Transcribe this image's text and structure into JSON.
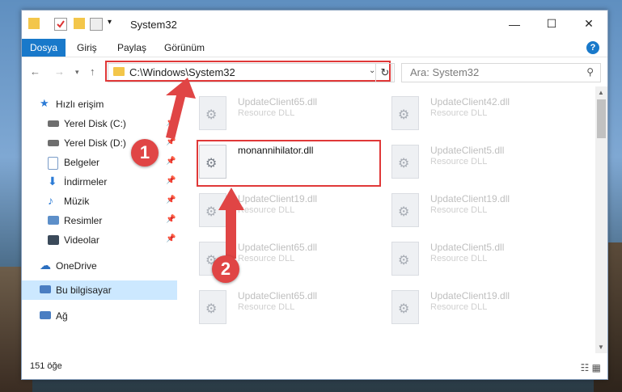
{
  "window": {
    "title": "System32"
  },
  "ribbon": {
    "tabs": [
      {
        "label": "Dosya",
        "active": true
      },
      {
        "label": "Giriş"
      },
      {
        "label": "Paylaş"
      },
      {
        "label": "Görünüm"
      }
    ],
    "help": "?"
  },
  "nav": {
    "address": "C:\\Windows\\System32",
    "search_placeholder": "Ara: System32"
  },
  "sidebar": {
    "items": [
      {
        "label": "Hızlı erişim",
        "icon": "star-icon"
      },
      {
        "label": "Yerel Disk (C:)",
        "icon": "drive-icon"
      },
      {
        "label": "Yerel Disk (D:)",
        "icon": "drive-icon"
      },
      {
        "label": "Belgeler",
        "icon": "documents-icon"
      },
      {
        "label": "İndirmeler",
        "icon": "download-icon"
      },
      {
        "label": "Müzik",
        "icon": "music-icon"
      },
      {
        "label": "Resimler",
        "icon": "pictures-icon"
      },
      {
        "label": "Videolar",
        "icon": "videos-icon"
      },
      {
        "label": "OneDrive",
        "icon": "cloud-icon"
      },
      {
        "label": "Bu bilgisayar",
        "icon": "computer-icon"
      },
      {
        "label": "Ağ",
        "icon": "network-icon"
      }
    ]
  },
  "files": [
    {
      "name": "UpdateClient65.dll",
      "type": "Resource DLL"
    },
    {
      "name": "UpdateClient42.dll",
      "type": "Resource DLL"
    },
    {
      "name": "monannihilator.dll",
      "type": ""
    },
    {
      "name": "UpdateClient5.dll",
      "type": "Resource DLL"
    },
    {
      "name": "UpdateClient19.dll",
      "type": "Resource DLL"
    },
    {
      "name": "UpdateClient19.dll",
      "type": "Resource DLL"
    },
    {
      "name": "UpdateClient65.dll",
      "type": "Resource DLL"
    },
    {
      "name": "UpdateClient5.dll",
      "type": "Resource DLL"
    },
    {
      "name": "UpdateClient65.dll",
      "type": "Resource DLL"
    },
    {
      "name": "UpdateClient19.dll",
      "type": "Resource DLL"
    }
  ],
  "status": {
    "count": "151 öğe"
  },
  "annotations": {
    "badge1": "1",
    "badge2": "2"
  },
  "colors": {
    "accent": "#1979ca",
    "highlight": "#e03838"
  }
}
